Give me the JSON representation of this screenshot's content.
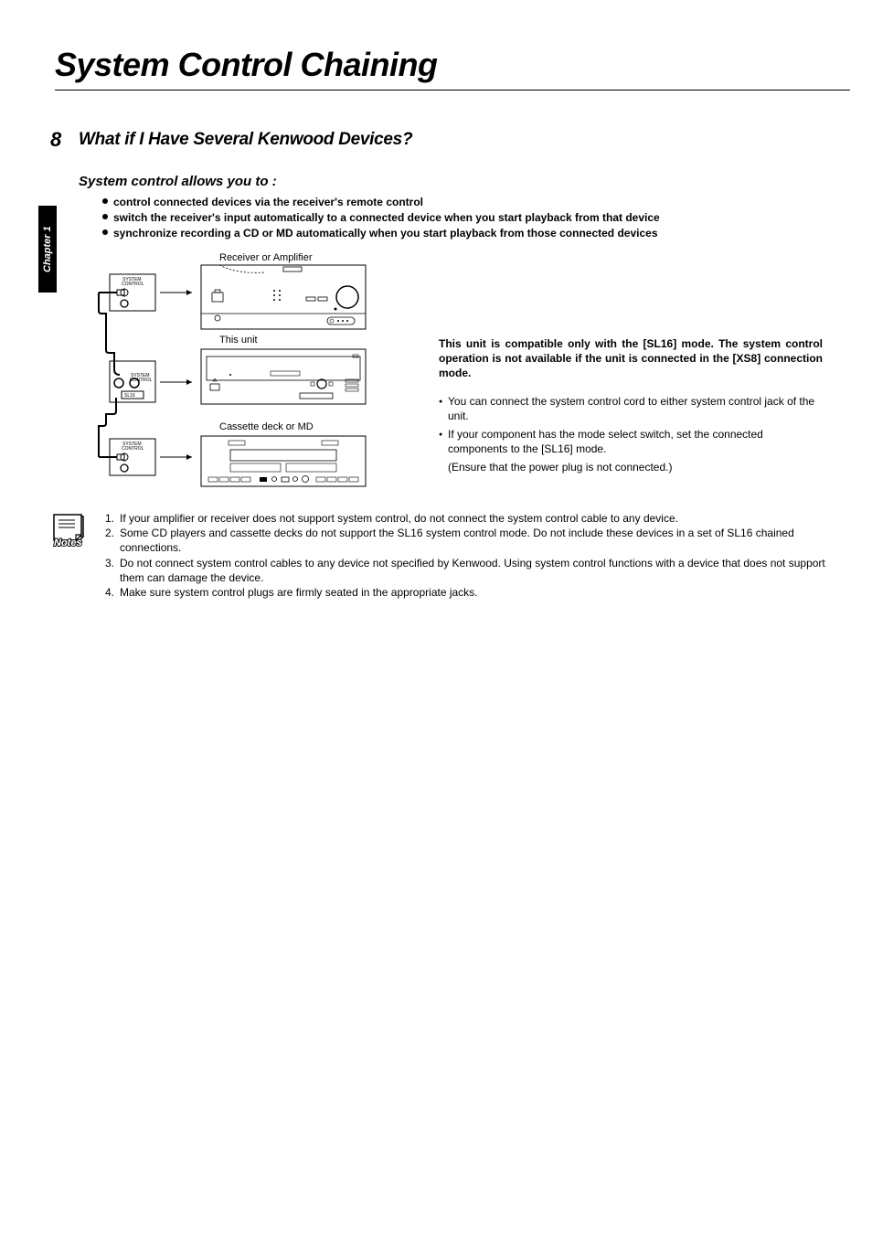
{
  "title": "System Control Chaining",
  "page_number": "8",
  "chapter_tab": "Chapter 1",
  "section_heading": "What if I Have Several Kenwood Devices?",
  "subheading": "System control allows you to :",
  "bullets": {
    "b1": "control connected devices via the receiver's remote control",
    "b2": "switch the receiver's input automatically to a connected device when you start playback from that device",
    "b3": "synchronize recording a CD or MD automatically when you start playback from those connected devices"
  },
  "diagram": {
    "label_receiver": "Receiver or Amplifier",
    "label_this_unit": "This unit",
    "label_cassette": "Cassette deck or MD",
    "panel_system_control": "SYSTEM\nCONTROL",
    "panel_sl16": "SL16"
  },
  "right_block": {
    "bold": "This unit is compatible only with the [SL16] mode. The system control operation is not available if the unit is connected in the [XS8] connection mode.",
    "p1": "You can connect the system control cord to either system control jack of the unit.",
    "p2": "If your component has the mode select switch, set the connected components to the [SL16] mode.",
    "p3": "(Ensure that the power plug is not connected.)"
  },
  "notes_label": "Notes",
  "notes": {
    "n1_num": "1.",
    "n1": "If your amplifier or receiver does not support system control, do not connect the system control cable to any device.",
    "n2_num": "2.",
    "n2": "Some CD players and cassette decks do not support the SL16 system control mode. Do not include these devices in a set of SL16 chained connections.",
    "n3_num": "3.",
    "n3": "Do not connect system control cables to any device not specified by Kenwood. Using system control functions with a device that does not support them can damage the device.",
    "n4_num": "4.",
    "n4": "Make sure system control plugs are firmly seated in the appropriate jacks."
  }
}
